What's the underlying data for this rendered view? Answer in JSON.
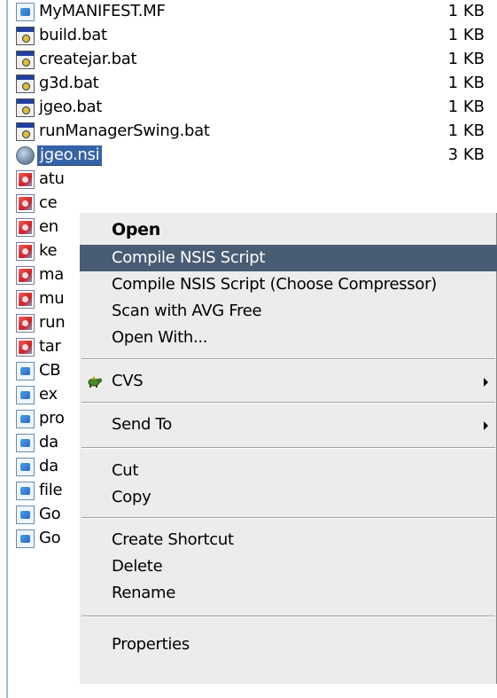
{
  "files": [
    {
      "name": "MyMANIFEST.MF",
      "size": "1 KB",
      "icon": "document-icon"
    },
    {
      "name": "build.bat",
      "size": "1 KB",
      "icon": "batch-file-icon"
    },
    {
      "name": "createjar.bat",
      "size": "1 KB",
      "icon": "batch-file-icon"
    },
    {
      "name": "g3d.bat",
      "size": "1 KB",
      "icon": "batch-file-icon"
    },
    {
      "name": "jgeo.bat",
      "size": "1 KB",
      "icon": "batch-file-icon"
    },
    {
      "name": "runManagerSwing.bat",
      "size": "1 KB",
      "icon": "batch-file-icon"
    },
    {
      "name": "jgeo.nsi",
      "size": "3 KB",
      "icon": "nsis-script-icon",
      "selected": true
    },
    {
      "name": "atu",
      "size": "",
      "icon": "image-file-icon"
    },
    {
      "name": "ce",
      "size": "",
      "icon": "image-file-icon"
    },
    {
      "name": "en",
      "size": "",
      "icon": "image-file-icon"
    },
    {
      "name": "ke",
      "size": "",
      "icon": "image-file-icon"
    },
    {
      "name": "ma",
      "size": "",
      "icon": "image-file-icon"
    },
    {
      "name": "mu",
      "size": "",
      "icon": "image-file-icon"
    },
    {
      "name": "run",
      "size": "",
      "icon": "image-file-icon"
    },
    {
      "name": "tar",
      "size": "",
      "icon": "image-file-icon"
    },
    {
      "name": "CB",
      "size": "",
      "icon": "document-icon"
    },
    {
      "name": "ex",
      "size": "",
      "icon": "document-icon"
    },
    {
      "name": "pro",
      "size": "",
      "icon": "document-icon"
    },
    {
      "name": "da",
      "size": "",
      "icon": "document-icon"
    },
    {
      "name": "da",
      "size": "",
      "icon": "document-icon"
    },
    {
      "name": "file",
      "size": "",
      "icon": "document-icon"
    },
    {
      "name": "Go",
      "size": "",
      "icon": "document-icon"
    },
    {
      "name": "Go",
      "size": "",
      "icon": "document-icon"
    }
  ],
  "context_menu": {
    "items": [
      {
        "label": "Open",
        "bold": true
      },
      {
        "label": "Compile NSIS Script",
        "highlighted": true
      },
      {
        "label": "Compile NSIS Script (Choose Compressor)"
      },
      {
        "label": "Scan with AVG Free"
      },
      {
        "label": "Open With..."
      },
      {
        "separator": true
      },
      {
        "label": "CVS",
        "submenu": true,
        "icon": "tortoise-cvs-icon"
      },
      {
        "separator": true
      },
      {
        "label": "Send To",
        "submenu": true
      },
      {
        "separator": true
      },
      {
        "label": "Cut"
      },
      {
        "label": "Copy"
      },
      {
        "separator": true
      },
      {
        "label": "Create Shortcut"
      },
      {
        "label": "Delete"
      },
      {
        "label": "Rename"
      },
      {
        "separator": true
      },
      {
        "label": "Properties"
      }
    ]
  },
  "colors": {
    "selection": "#3563a8",
    "menu_background": "#ececec",
    "menu_highlight": "#485c74"
  }
}
